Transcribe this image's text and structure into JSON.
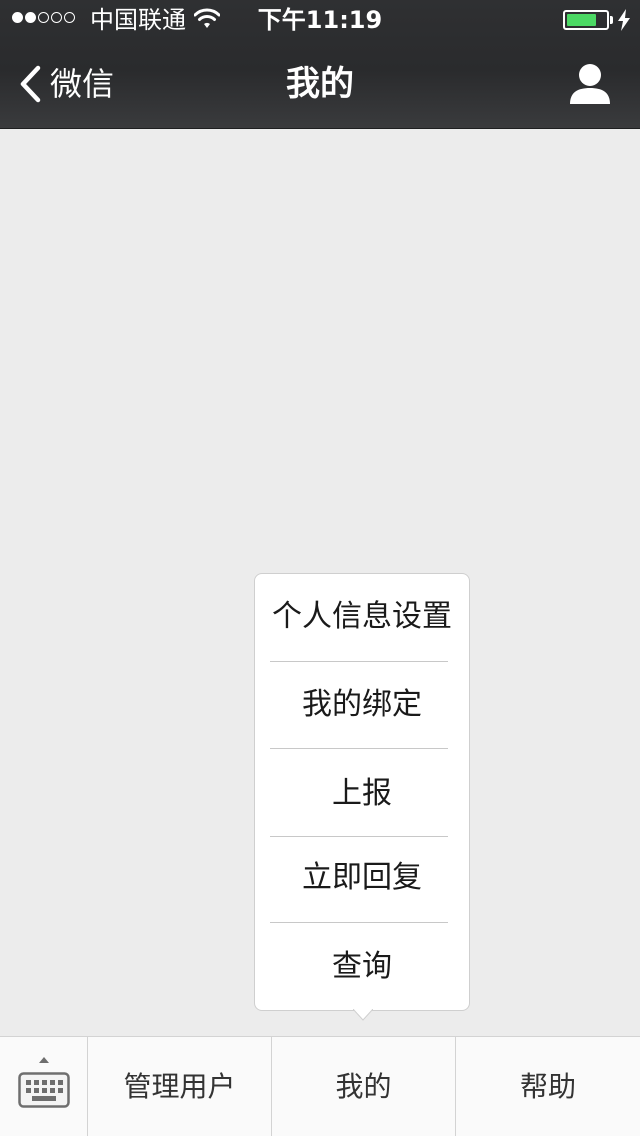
{
  "status_bar": {
    "carrier": "中国联通",
    "time": "下午11:19",
    "signal_strength": 2,
    "signal_max": 5,
    "battery_level": 0.75,
    "battery_color": "#4cd964",
    "icons": [
      "wifi-icon",
      "battery-icon",
      "charging-icon"
    ]
  },
  "nav": {
    "back_label": "微信",
    "title": "我的",
    "right_icon": "person-icon"
  },
  "popup_menu": {
    "items": [
      {
        "label": "个人信息设置"
      },
      {
        "label": "我的绑定"
      },
      {
        "label": "上报"
      },
      {
        "label": "立即回复"
      },
      {
        "label": "查询"
      }
    ]
  },
  "bottom_menu": {
    "keyboard_icon": "keyboard-icon",
    "tabs": [
      {
        "label": "管理用户"
      },
      {
        "label": "我的"
      },
      {
        "label": "帮助"
      }
    ]
  },
  "colors": {
    "header_bg": "#2d2e30",
    "page_bg": "#ececec",
    "text_on_header": "#ffffff",
    "menu_text": "#1a1a1a"
  }
}
